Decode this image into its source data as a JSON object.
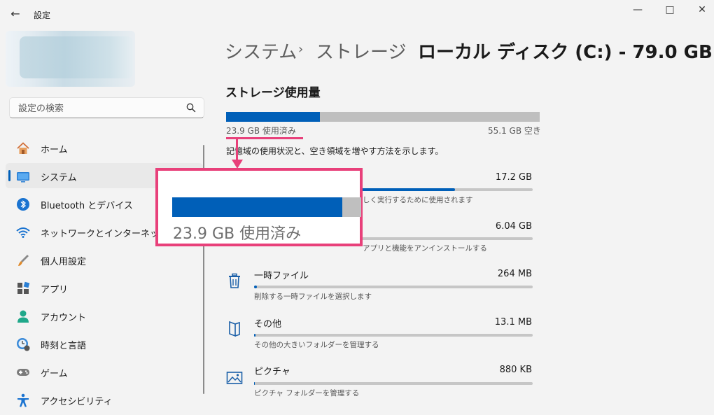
{
  "window": {
    "title": "設定",
    "back_glyph": "←",
    "minimize_glyph": "—",
    "maximize_glyph": "□",
    "close_glyph": "✕"
  },
  "search": {
    "placeholder": "設定の検索"
  },
  "sidebar": {
    "items": [
      {
        "label": "ホーム",
        "icon": "home-icon"
      },
      {
        "label": "システム",
        "icon": "system-icon",
        "active": true
      },
      {
        "label": "Bluetooth とデバイス",
        "icon": "bluetooth-icon"
      },
      {
        "label": "ネットワークとインターネット",
        "icon": "wifi-icon"
      },
      {
        "label": "個人用設定",
        "icon": "brush-icon"
      },
      {
        "label": "アプリ",
        "icon": "apps-icon"
      },
      {
        "label": "アカウント",
        "icon": "account-icon"
      },
      {
        "label": "時刻と言語",
        "icon": "time-language-icon"
      },
      {
        "label": "ゲーム",
        "icon": "gamepad-icon"
      },
      {
        "label": "アクセシビリティ",
        "icon": "accessibility-icon"
      }
    ]
  },
  "breadcrumb": {
    "system": "システム",
    "sep": "›",
    "storage": "ストレージ",
    "current": "ローカル ディスク (C:) - 79.0 GB"
  },
  "storage": {
    "section_title": "ストレージ使用量",
    "used_label": "23.9 GB 使用済み",
    "free_label": "55.1 GB 空き",
    "used_fraction": 0.3,
    "description": "記憶域の使用状況と、空き領域を増やす方法を示します。",
    "categories": [
      {
        "name": "",
        "size": "17.2 GB",
        "desc": "しく実行するために使用されます",
        "fraction": 0.72,
        "icon": "system-files-icon"
      },
      {
        "name": "",
        "size": "6.04 GB",
        "desc": "アプリと機能をアンインストールする",
        "fraction": 0.25,
        "icon": "apps-storage-icon"
      },
      {
        "name": "一時ファイル",
        "size": "264 MB",
        "desc": "削除する一時ファイルを選択します",
        "fraction": 0.011,
        "icon": "trash-icon"
      },
      {
        "name": "その他",
        "size": "13.1 MB",
        "desc": "その他の大きいフォルダーを管理する",
        "fraction": 0.002,
        "icon": "other-folder-icon"
      },
      {
        "name": "ピクチャ",
        "size": "880 KB",
        "desc": "ピクチャ フォルダーを管理する",
        "fraction": 0.001,
        "icon": "pictures-icon"
      }
    ]
  },
  "callout": {
    "text": "23.9 GB 使用済み",
    "fraction": 0.9
  },
  "colors": {
    "accent": "#005fb8",
    "highlight": "#e8407a",
    "bar_track": "#bfbfbf"
  }
}
